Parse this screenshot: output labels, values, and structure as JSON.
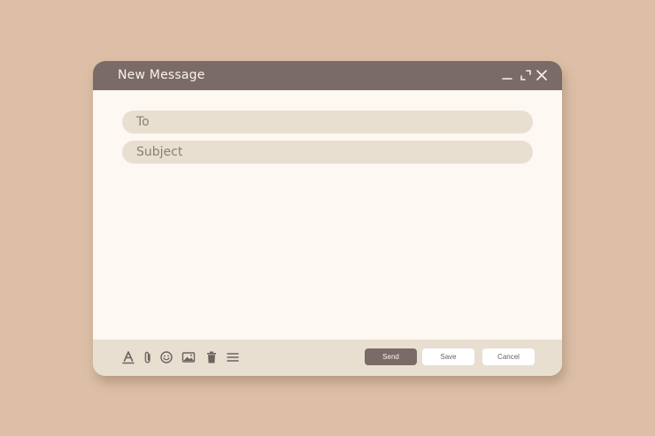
{
  "window": {
    "title": "New Message",
    "controls": {
      "minimize_icon": "minimize-icon",
      "maximize_icon": "maximize-icon",
      "close_icon": "close-icon"
    }
  },
  "form": {
    "to_placeholder": "To",
    "to_value": "",
    "subject_placeholder": "Subject",
    "subject_value": "",
    "body_value": ""
  },
  "toolbar": {
    "tools": [
      {
        "icon": "text-format-icon"
      },
      {
        "icon": "paperclip-icon"
      },
      {
        "icon": "emoji-icon"
      },
      {
        "icon": "image-icon"
      },
      {
        "icon": "trash-icon"
      },
      {
        "icon": "menu-lines-icon"
      }
    ],
    "send_label": "Send",
    "save_label": "Save",
    "cancel_label": "Cancel"
  },
  "colors": {
    "background": "#dcbfa6",
    "titlebar": "#7a6b68",
    "window": "#fdf8f1",
    "field": "#e8dfd0",
    "send_button": "#7a6b68",
    "button_light": "#ffffff",
    "title_text": "#fbf4ea",
    "icon": "#6e6260"
  }
}
